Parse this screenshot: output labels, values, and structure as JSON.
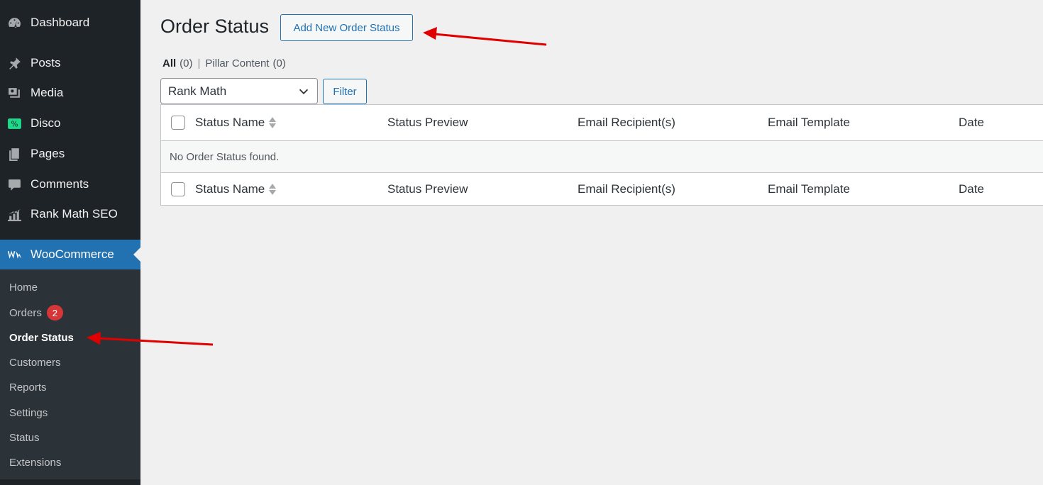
{
  "sidebar": {
    "items": [
      {
        "label": "Dashboard",
        "icon": "dashboard-icon"
      },
      {
        "label": "Posts",
        "icon": "pin-icon"
      },
      {
        "label": "Media",
        "icon": "media-icon"
      },
      {
        "label": "Disco",
        "icon": "disco-icon"
      },
      {
        "label": "Pages",
        "icon": "pages-icon"
      },
      {
        "label": "Comments",
        "icon": "comment-icon"
      },
      {
        "label": "Rank Math SEO",
        "icon": "rank-math-icon"
      }
    ],
    "woocommerce": {
      "label": "WooCommerce",
      "icon": "woocommerce-icon"
    },
    "submenu": [
      {
        "label": "Home"
      },
      {
        "label": "Orders",
        "badge": "2"
      },
      {
        "label": "Order Status",
        "current": true
      },
      {
        "label": "Customers"
      },
      {
        "label": "Reports"
      },
      {
        "label": "Settings"
      },
      {
        "label": "Status"
      },
      {
        "label": "Extensions"
      }
    ]
  },
  "page": {
    "title": "Order Status",
    "add_button": "Add New Order Status",
    "views": {
      "all_label": "All",
      "all_count": "(0)",
      "separator": "|",
      "pillar_label": "Pillar Content",
      "pillar_count": "(0)"
    },
    "filter": {
      "select_value": "Rank Math",
      "button_label": "Filter"
    },
    "table": {
      "columns": [
        "Status Name",
        "Status Preview",
        "Email Recipient(s)",
        "Email Template",
        "Date"
      ],
      "empty_message": "No Order Status found."
    }
  },
  "colors": {
    "sidebar_bg": "#1d2327",
    "submenu_bg": "#2c3338",
    "accent": "#2271b1",
    "badge": "#d63638",
    "annotation_arrow": "#e00000"
  }
}
